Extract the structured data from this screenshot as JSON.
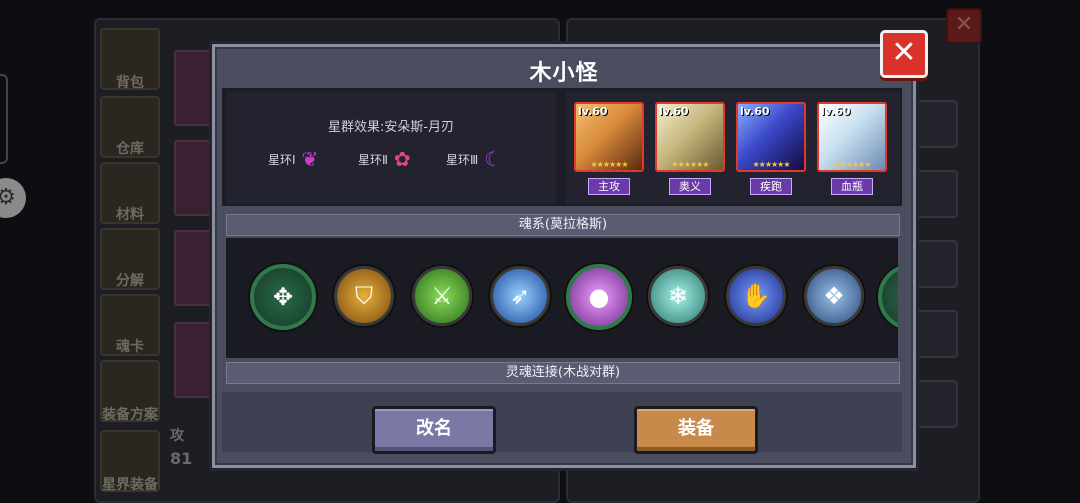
{
  "background": {
    "sidebar": [
      "背包",
      "仓库",
      "材料",
      "分解",
      "魂卡",
      "装备方案",
      "星界装备"
    ],
    "attack_label": "攻",
    "attack_value": "81"
  },
  "dialog": {
    "title": "木小怪",
    "close_icon": "close-x",
    "set_effect": "星群效果:安朵斯-月刃",
    "rings": [
      {
        "label": "星环Ⅰ",
        "icon": "crescent-bird-icon",
        "color": "#c93cd6"
      },
      {
        "label": "星环Ⅱ",
        "icon": "flower-icon",
        "color": "#e2467a"
      },
      {
        "label": "星环Ⅲ",
        "icon": "crescent-moon-icon",
        "color": "#a040e0"
      }
    ],
    "heroes": [
      {
        "level": "lv.60",
        "tag": "主攻",
        "palette": "#d88a3a"
      },
      {
        "level": "lv.60",
        "tag": "奥义",
        "palette": "#c8b880"
      },
      {
        "level": "lv.60",
        "tag": "疾跑",
        "palette": "#3a48c8"
      },
      {
        "level": "lv.60",
        "tag": "血瓶",
        "palette": "#c8e0f0"
      }
    ],
    "soul_section": "魂系(莫拉格斯)",
    "souls": [
      {
        "icon": "crossed-tools-icon",
        "glyph": "✥",
        "color": "#3fa06a",
        "framed": true
      },
      {
        "icon": "gold-helmet-icon",
        "glyph": "⛉",
        "color": "#c8901a",
        "framed": false
      },
      {
        "icon": "green-sword-icon",
        "glyph": "⚔",
        "color": "#6ac83a",
        "framed": false
      },
      {
        "icon": "blue-arrow-icon",
        "glyph": "➶",
        "color": "#3a8ae0",
        "framed": false
      },
      {
        "icon": "purple-orb-icon",
        "glyph": "●",
        "color": "#b050d8",
        "framed": true
      },
      {
        "icon": "cyan-swirl-icon",
        "glyph": "❄",
        "color": "#5ac8c0",
        "framed": false
      },
      {
        "icon": "blue-hand-icon",
        "glyph": "✋",
        "color": "#3a60d8",
        "framed": false
      },
      {
        "icon": "blue-book-icon",
        "glyph": "❖",
        "color": "#4a7ab8",
        "framed": false
      },
      {
        "icon": "green-partial-icon",
        "glyph": "✥",
        "color": "#3fa06a",
        "framed": true
      }
    ],
    "link_section": "灵魂连接(木战对群)",
    "buttons": {
      "rename": "改名",
      "equip": "装备"
    }
  }
}
